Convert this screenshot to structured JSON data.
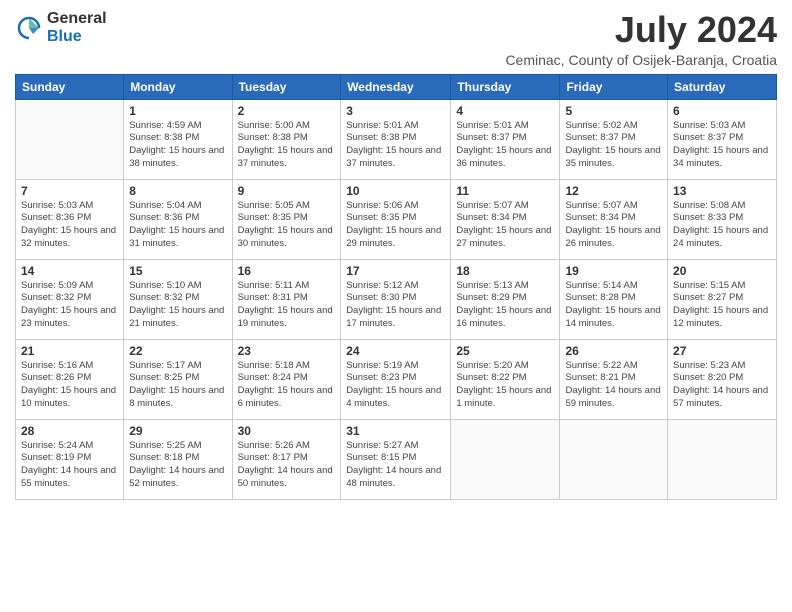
{
  "logo": {
    "general": "General",
    "blue": "Blue"
  },
  "title": "July 2024",
  "location": "Ceminac, County of Osijek-Baranja, Croatia",
  "weekdays": [
    "Sunday",
    "Monday",
    "Tuesday",
    "Wednesday",
    "Thursday",
    "Friday",
    "Saturday"
  ],
  "weeks": [
    [
      {
        "day": "",
        "empty": true
      },
      {
        "day": "1",
        "sunrise": "4:59 AM",
        "sunset": "8:38 PM",
        "daylight": "15 hours and 38 minutes."
      },
      {
        "day": "2",
        "sunrise": "5:00 AM",
        "sunset": "8:38 PM",
        "daylight": "15 hours and 37 minutes."
      },
      {
        "day": "3",
        "sunrise": "5:01 AM",
        "sunset": "8:38 PM",
        "daylight": "15 hours and 37 minutes."
      },
      {
        "day": "4",
        "sunrise": "5:01 AM",
        "sunset": "8:37 PM",
        "daylight": "15 hours and 36 minutes."
      },
      {
        "day": "5",
        "sunrise": "5:02 AM",
        "sunset": "8:37 PM",
        "daylight": "15 hours and 35 minutes."
      },
      {
        "day": "6",
        "sunrise": "5:03 AM",
        "sunset": "8:37 PM",
        "daylight": "15 hours and 34 minutes."
      }
    ],
    [
      {
        "day": "7",
        "sunrise": "5:03 AM",
        "sunset": "8:36 PM",
        "daylight": "15 hours and 32 minutes."
      },
      {
        "day": "8",
        "sunrise": "5:04 AM",
        "sunset": "8:36 PM",
        "daylight": "15 hours and 31 minutes."
      },
      {
        "day": "9",
        "sunrise": "5:05 AM",
        "sunset": "8:35 PM",
        "daylight": "15 hours and 30 minutes."
      },
      {
        "day": "10",
        "sunrise": "5:06 AM",
        "sunset": "8:35 PM",
        "daylight": "15 hours and 29 minutes."
      },
      {
        "day": "11",
        "sunrise": "5:07 AM",
        "sunset": "8:34 PM",
        "daylight": "15 hours and 27 minutes."
      },
      {
        "day": "12",
        "sunrise": "5:07 AM",
        "sunset": "8:34 PM",
        "daylight": "15 hours and 26 minutes."
      },
      {
        "day": "13",
        "sunrise": "5:08 AM",
        "sunset": "8:33 PM",
        "daylight": "15 hours and 24 minutes."
      }
    ],
    [
      {
        "day": "14",
        "sunrise": "5:09 AM",
        "sunset": "8:32 PM",
        "daylight": "15 hours and 23 minutes."
      },
      {
        "day": "15",
        "sunrise": "5:10 AM",
        "sunset": "8:32 PM",
        "daylight": "15 hours and 21 minutes."
      },
      {
        "day": "16",
        "sunrise": "5:11 AM",
        "sunset": "8:31 PM",
        "daylight": "15 hours and 19 minutes."
      },
      {
        "day": "17",
        "sunrise": "5:12 AM",
        "sunset": "8:30 PM",
        "daylight": "15 hours and 17 minutes."
      },
      {
        "day": "18",
        "sunrise": "5:13 AM",
        "sunset": "8:29 PM",
        "daylight": "15 hours and 16 minutes."
      },
      {
        "day": "19",
        "sunrise": "5:14 AM",
        "sunset": "8:28 PM",
        "daylight": "15 hours and 14 minutes."
      },
      {
        "day": "20",
        "sunrise": "5:15 AM",
        "sunset": "8:27 PM",
        "daylight": "15 hours and 12 minutes."
      }
    ],
    [
      {
        "day": "21",
        "sunrise": "5:16 AM",
        "sunset": "8:26 PM",
        "daylight": "15 hours and 10 minutes."
      },
      {
        "day": "22",
        "sunrise": "5:17 AM",
        "sunset": "8:25 PM",
        "daylight": "15 hours and 8 minutes."
      },
      {
        "day": "23",
        "sunrise": "5:18 AM",
        "sunset": "8:24 PM",
        "daylight": "15 hours and 6 minutes."
      },
      {
        "day": "24",
        "sunrise": "5:19 AM",
        "sunset": "8:23 PM",
        "daylight": "15 hours and 4 minutes."
      },
      {
        "day": "25",
        "sunrise": "5:20 AM",
        "sunset": "8:22 PM",
        "daylight": "15 hours and 1 minute."
      },
      {
        "day": "26",
        "sunrise": "5:22 AM",
        "sunset": "8:21 PM",
        "daylight": "14 hours and 59 minutes."
      },
      {
        "day": "27",
        "sunrise": "5:23 AM",
        "sunset": "8:20 PM",
        "daylight": "14 hours and 57 minutes."
      }
    ],
    [
      {
        "day": "28",
        "sunrise": "5:24 AM",
        "sunset": "8:19 PM",
        "daylight": "14 hours and 55 minutes."
      },
      {
        "day": "29",
        "sunrise": "5:25 AM",
        "sunset": "8:18 PM",
        "daylight": "14 hours and 52 minutes."
      },
      {
        "day": "30",
        "sunrise": "5:26 AM",
        "sunset": "8:17 PM",
        "daylight": "14 hours and 50 minutes."
      },
      {
        "day": "31",
        "sunrise": "5:27 AM",
        "sunset": "8:15 PM",
        "daylight": "14 hours and 48 minutes."
      },
      {
        "day": "",
        "empty": true
      },
      {
        "day": "",
        "empty": true
      },
      {
        "day": "",
        "empty": true
      }
    ]
  ]
}
